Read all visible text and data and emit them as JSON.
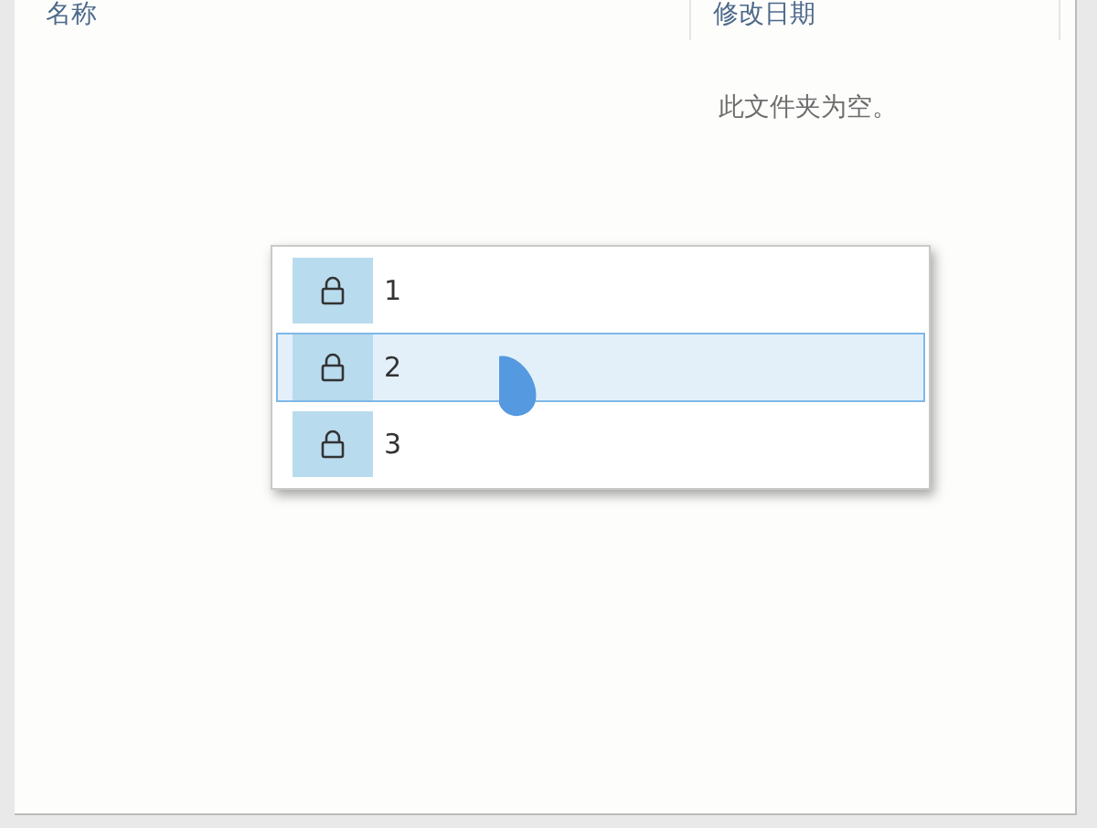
{
  "columns": [
    {
      "label": "名称"
    },
    {
      "label": "修改日期"
    }
  ],
  "empty_message": "此文件夹为空。",
  "menu": {
    "items": [
      {
        "label": "1",
        "selected": false
      },
      {
        "label": "2",
        "selected": true
      },
      {
        "label": "3",
        "selected": false
      }
    ]
  }
}
